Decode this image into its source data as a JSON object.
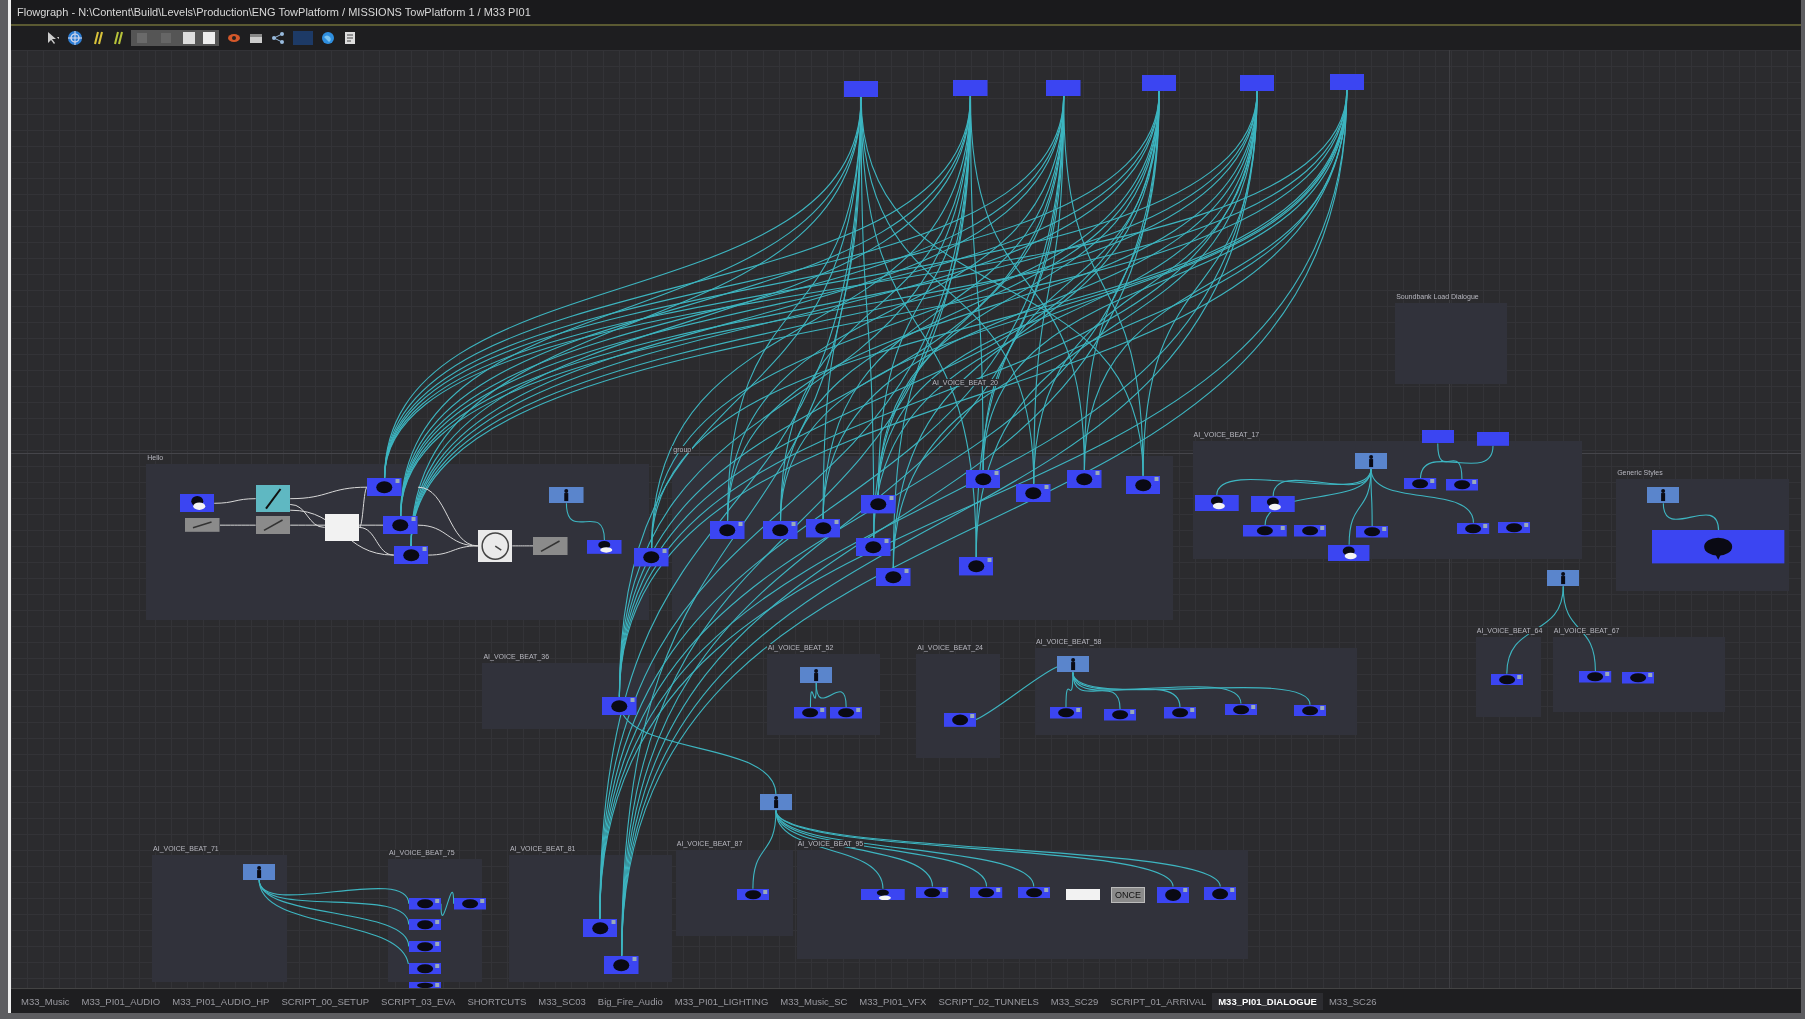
{
  "window": {
    "title": "Flowgraph - N:\\Content\\Build\\Levels\\Production\\ENG TowPlatform / MISSIONS TowPlatform 1 / M33 PI01"
  },
  "canvas": {
    "groups": [
      {
        "label": "Hello"
      },
      {
        "label": "group"
      },
      {
        "label": "AI_VOICE_BEAT_20"
      },
      {
        "label": "AI_VOICE_BEAT_17"
      },
      {
        "label": "Soundbank Load Dialogue"
      },
      {
        "label": "Generic Styles"
      },
      {
        "label": "AI_VOICE_BEAT_36"
      },
      {
        "label": "AI_VOICE_BEAT_52"
      },
      {
        "label": "AI_VOICE_BEAT_24"
      },
      {
        "label": "AI_VOICE_BEAT_58"
      },
      {
        "label": "AI_VOICE_BEAT_64"
      },
      {
        "label": "AI_VOICE_BEAT_67"
      },
      {
        "label": "AI_VOICE_BEAT_71"
      },
      {
        "label": "AI_VOICE_BEAT_75"
      },
      {
        "label": "AI_VOICE_BEAT_81"
      },
      {
        "label": "AI_VOICE_BEAT_87"
      },
      {
        "label": "AI_VOICE_BEAT_95"
      }
    ],
    "labeled_nodes": [
      {
        "label": "ONCE"
      }
    ]
  },
  "tabs": [
    {
      "label": "M33_Music",
      "selected": false
    },
    {
      "label": "M33_PI01_AUDIO",
      "selected": false
    },
    {
      "label": "M33_PI01_AUDIO_HP",
      "selected": false
    },
    {
      "label": "SCRIPT_00_SETUP",
      "selected": false
    },
    {
      "label": "SCRIPT_03_EVA",
      "selected": false
    },
    {
      "label": "SHORTCUTS",
      "selected": false
    },
    {
      "label": "M33_SC03",
      "selected": false
    },
    {
      "label": "Big_Fire_Audio",
      "selected": false
    },
    {
      "label": "M33_PI01_LIGHTING",
      "selected": false
    },
    {
      "label": "M33_Music_SC",
      "selected": false
    },
    {
      "label": "M33_PI01_VFX",
      "selected": false
    },
    {
      "label": "SCRIPT_02_TUNNELS",
      "selected": false
    },
    {
      "label": "M33_SC29",
      "selected": false
    },
    {
      "label": "SCRIPT_01_ARRIVAL",
      "selected": false
    },
    {
      "label": "M33_PI01_DIALOGUE",
      "selected": true
    },
    {
      "label": "M33_SC26",
      "selected": false
    }
  ]
}
